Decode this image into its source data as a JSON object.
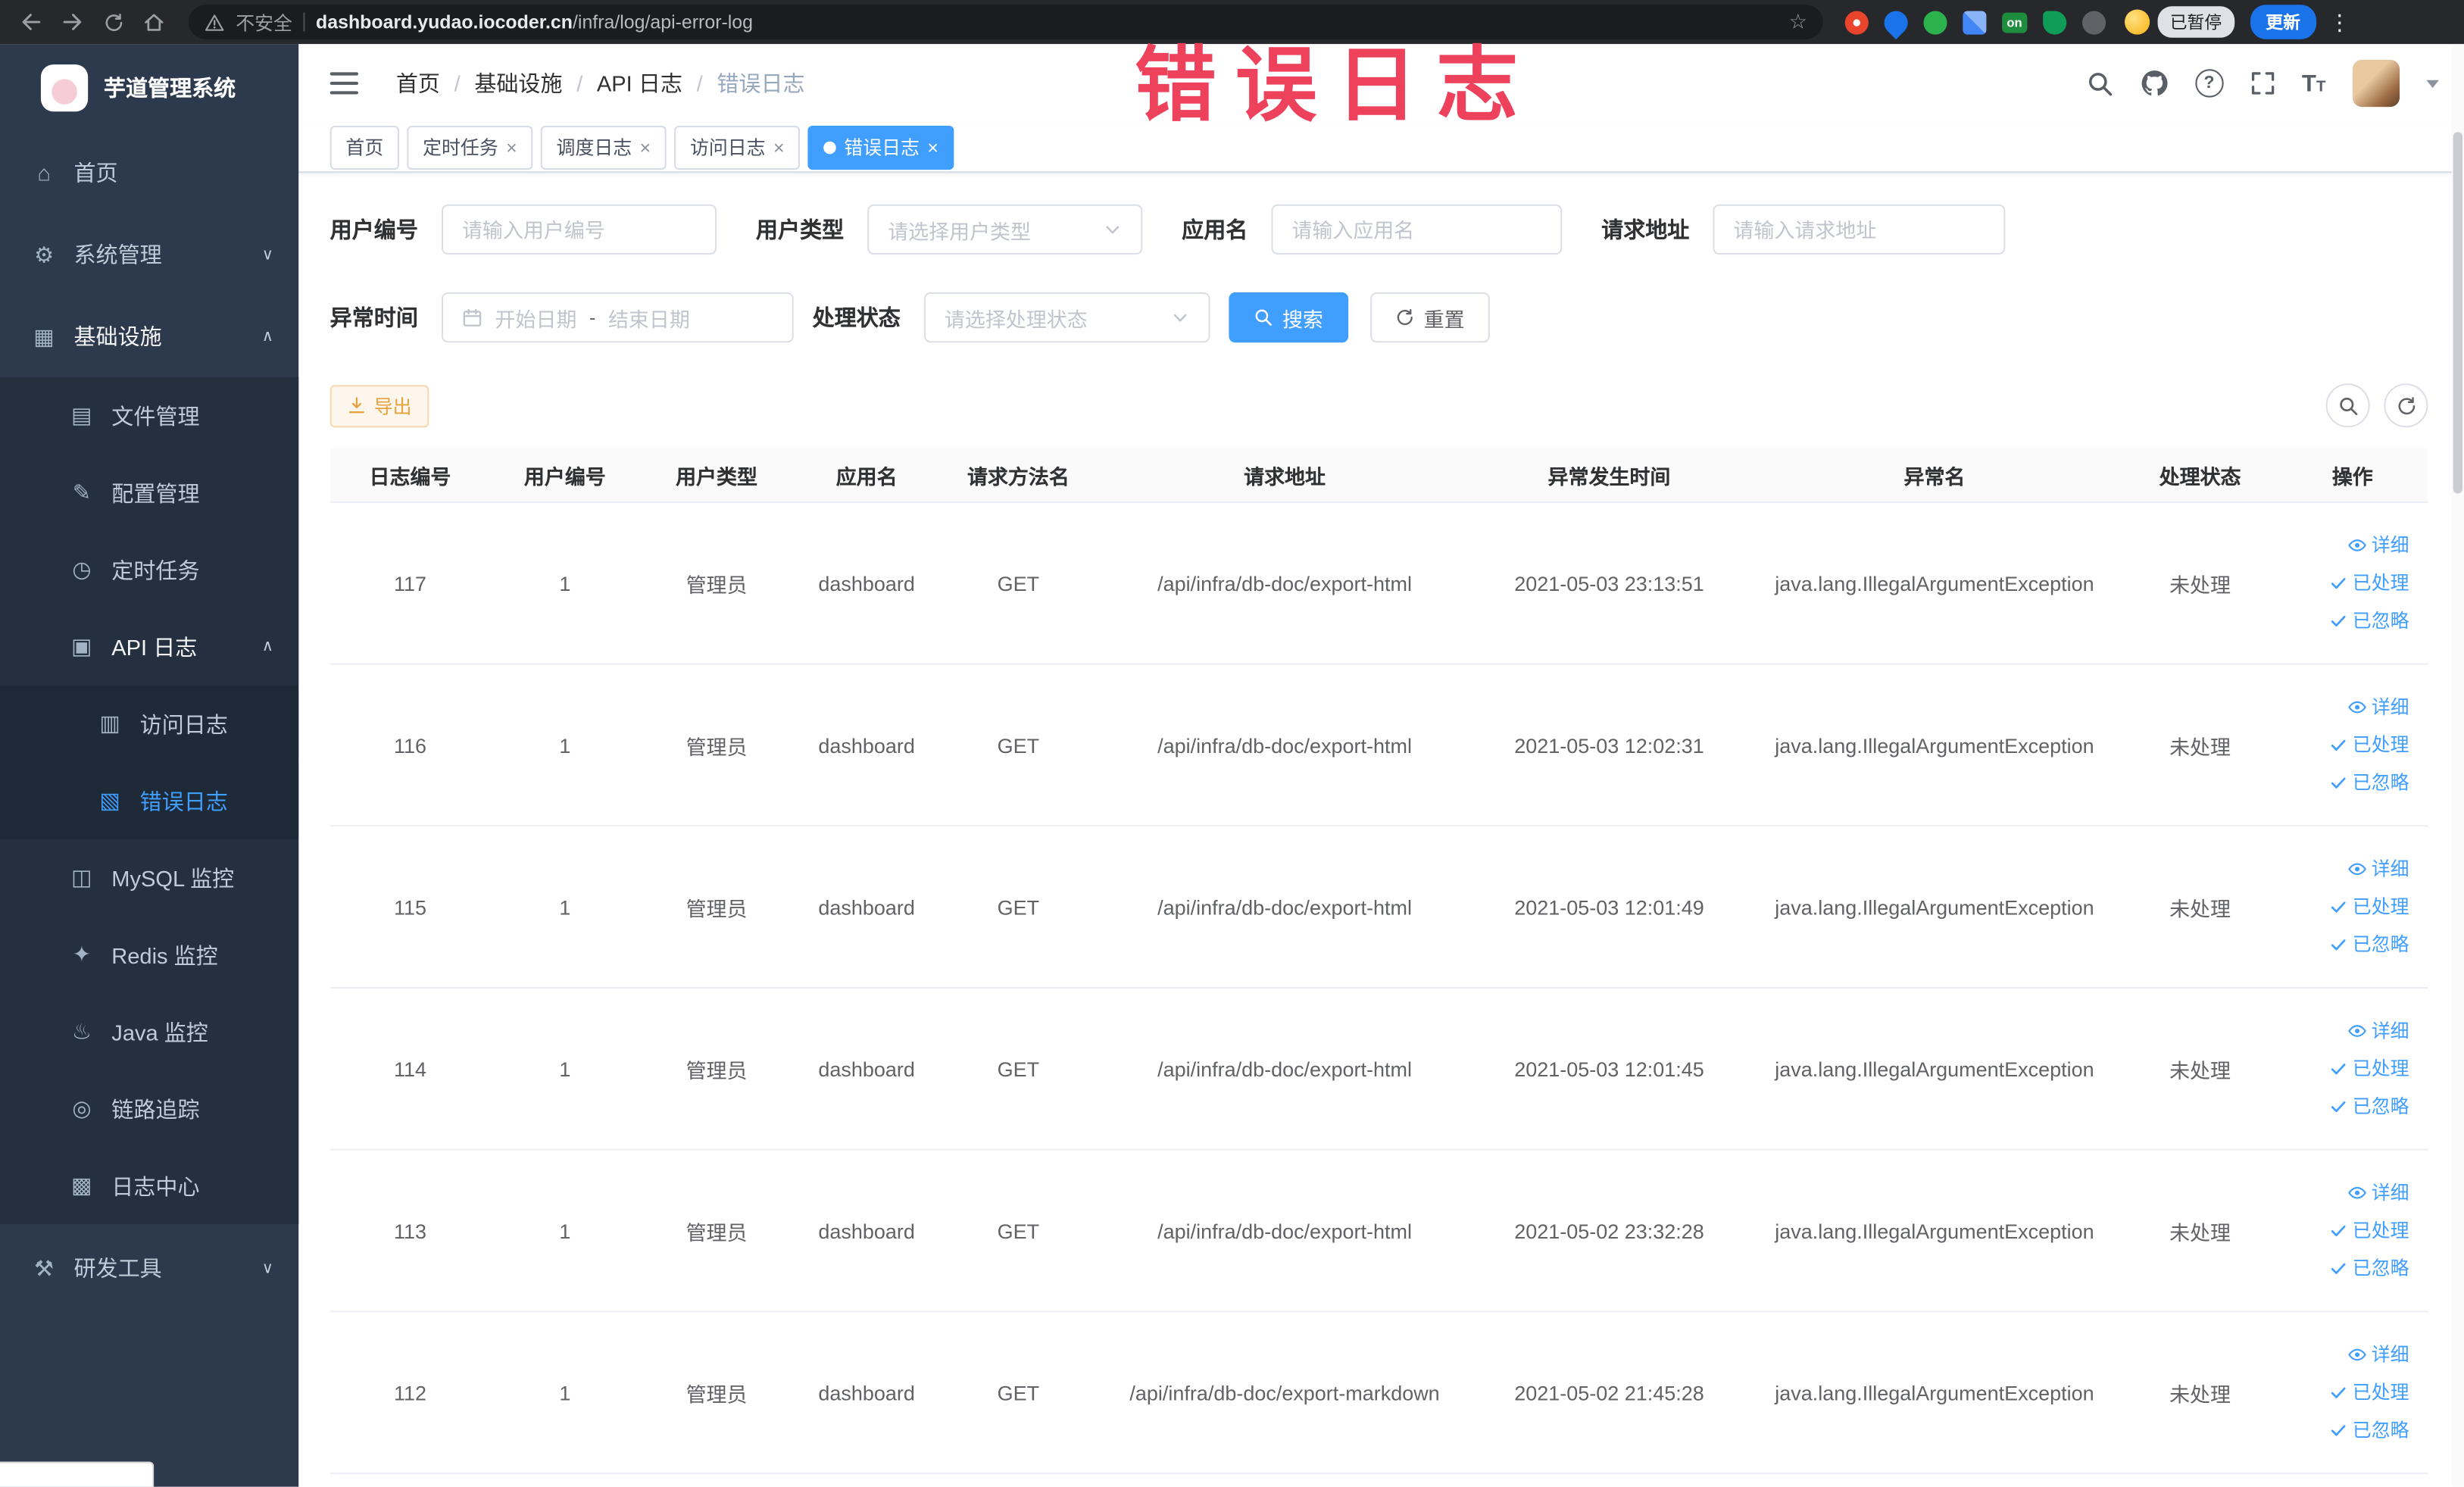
{
  "browser": {
    "security_label": "不安全",
    "url_domain": "dashboard.yudao.iocoder.cn",
    "url_path": "/infra/log/api-error-log",
    "extension_badge": "on",
    "profile_chip": "已暂停",
    "update_label": "更新"
  },
  "annotation": {
    "text": "错误日志"
  },
  "icons": {
    "home": "⌂",
    "gear": "⚙",
    "infra": "▦",
    "file": "▤",
    "config": "✎",
    "timer": "◷",
    "api_log": "▣",
    "access_log": "▥",
    "error_log": "▧",
    "mysql": "◫",
    "redis": "✦",
    "java": "♨",
    "trace": "◎",
    "log_center": "▩",
    "dev_tools": "⚒",
    "chevron_down": "∨",
    "chevron_up": "∧",
    "star": "☆",
    "kebab": "⋮",
    "question": "?",
    "close": "×",
    "text_size_big": "T",
    "text_size_small": "T"
  },
  "sidebar": {
    "logo_title": "芋道管理系统",
    "items": [
      "首页",
      "系统管理",
      "基础设施",
      "文件管理",
      "配置管理",
      "定时任务",
      "API 日志",
      "访问日志",
      "错误日志",
      "MySQL 监控",
      "Redis 监控",
      "Java 监控",
      "链路追踪",
      "日志中心",
      "研发工具"
    ]
  },
  "breadcrumb": {
    "items": [
      "首页",
      "基础设施",
      "API 日志",
      "错误日志"
    ],
    "separator": "/"
  },
  "tags": [
    "首页",
    "定时任务",
    "调度日志",
    "访问日志",
    "错误日志"
  ],
  "filters": {
    "user_id_label": "用户编号",
    "user_id_placeholder": "请输入用户编号",
    "user_type_label": "用户类型",
    "user_type_placeholder": "请选择用户类型",
    "app_name_label": "应用名",
    "app_name_placeholder": "请输入应用名",
    "request_url_label": "请求地址",
    "request_url_placeholder": "请输入请求地址",
    "exception_time_label": "异常时间",
    "start_placeholder": "开始日期",
    "range_separator": "-",
    "end_placeholder": "结束日期",
    "status_label": "处理状态",
    "status_placeholder": "请选择处理状态",
    "search_label": "搜索",
    "reset_label": "重置"
  },
  "toolbar": {
    "export_label": "导出"
  },
  "table": {
    "columns": [
      "日志编号",
      "用户编号",
      "用户类型",
      "应用名",
      "请求方法名",
      "请求地址",
      "异常发生时间",
      "异常名",
      "处理状态",
      "操作"
    ],
    "row_actions": {
      "detail": "详细",
      "processed": "已处理",
      "ignored": "已忽略"
    },
    "rows": [
      {
        "log_id": "117",
        "user_id": "1",
        "user_type": "管理员",
        "app_name": "dashboard",
        "method": "GET",
        "url": "/api/infra/db-doc/export-html",
        "time": "2021-05-03 23:13:51",
        "exception": "java.lang.IllegalArgumentException",
        "status": "未处理"
      },
      {
        "log_id": "116",
        "user_id": "1",
        "user_type": "管理员",
        "app_name": "dashboard",
        "method": "GET",
        "url": "/api/infra/db-doc/export-html",
        "time": "2021-05-03 12:02:31",
        "exception": "java.lang.IllegalArgumentException",
        "status": "未处理"
      },
      {
        "log_id": "115",
        "user_id": "1",
        "user_type": "管理员",
        "app_name": "dashboard",
        "method": "GET",
        "url": "/api/infra/db-doc/export-html",
        "time": "2021-05-03 12:01:49",
        "exception": "java.lang.IllegalArgumentException",
        "status": "未处理"
      },
      {
        "log_id": "114",
        "user_id": "1",
        "user_type": "管理员",
        "app_name": "dashboard",
        "method": "GET",
        "url": "/api/infra/db-doc/export-html",
        "time": "2021-05-03 12:01:45",
        "exception": "java.lang.IllegalArgumentException",
        "status": "未处理"
      },
      {
        "log_id": "113",
        "user_id": "1",
        "user_type": "管理员",
        "app_name": "dashboard",
        "method": "GET",
        "url": "/api/infra/db-doc/export-html",
        "time": "2021-05-02 23:32:28",
        "exception": "java.lang.IllegalArgumentException",
        "status": "未处理"
      },
      {
        "log_id": "112",
        "user_id": "1",
        "user_type": "管理员",
        "app_name": "dashboard",
        "method": "GET",
        "url": "/api/infra/db-doc/export-markdown",
        "time": "2021-05-02 21:45:28",
        "exception": "java.lang.IllegalArgumentException",
        "status": "未处理"
      }
    ]
  }
}
